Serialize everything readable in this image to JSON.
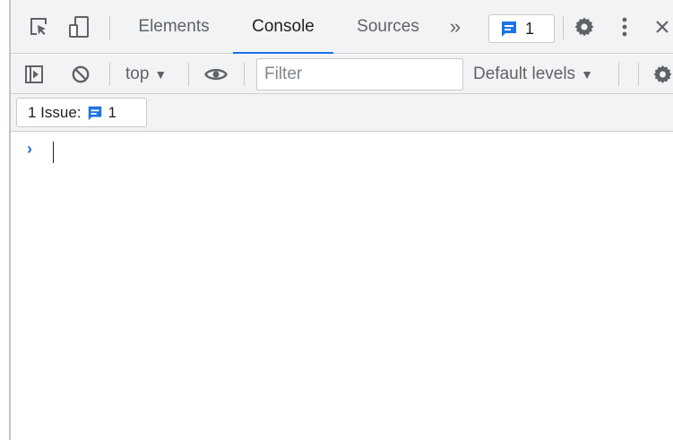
{
  "tabs": [
    {
      "label": "Elements",
      "active": false
    },
    {
      "label": "Console",
      "active": true
    },
    {
      "label": "Sources",
      "active": false
    }
  ],
  "more_tabs_glyph": "»",
  "issues_badge": {
    "count": "1",
    "icon": "message-square-icon"
  },
  "toolbar": {
    "context": "top",
    "context_arrow": "▼",
    "filter_placeholder": "Filter",
    "levels": "Default levels",
    "levels_arrow": "▼"
  },
  "issues_bar": {
    "label": "1 Issue:",
    "count": "1"
  },
  "console": {
    "prompt": "›"
  },
  "colors": {
    "accent": "#1a73e8",
    "toolbar_bg": "#f1f3f4",
    "icon": "#5f6368"
  }
}
